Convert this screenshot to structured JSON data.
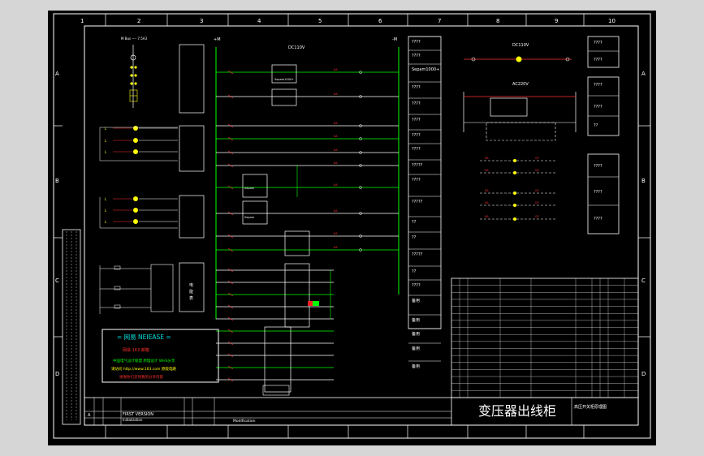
{
  "grid": {
    "columns": [
      "1",
      "2",
      "3",
      "4",
      "5",
      "6",
      "7",
      "8",
      "9",
      "10"
    ],
    "rows": [
      "A",
      "B",
      "C",
      "D"
    ]
  },
  "title_block": {
    "title": "变压器出线柜",
    "subtitle": "高压开关柜原理图",
    "revision_col": "A",
    "version_label": "FIRST VERSION",
    "version_sub": "Initialization",
    "modification": "Modification"
  },
  "dc_bus": {
    "left": "+M",
    "right": "-M",
    "label": "DC110V"
  },
  "ac_bus": {
    "label": "AC220V"
  },
  "dc_panel": {
    "label": "DC110V"
  },
  "relay_label": "Sepam1000+",
  "relay_label_short": "Sepam",
  "watermark": {
    "title": "= 网易 NEIEASE =",
    "lines": [
      "网易 163 邮箱",
      "中国电气设计联盟 原理设计 WHS分享",
      "请访问 http://www.163.com 原版电路",
      "谢谢你们支持我的分享内容"
    ]
  },
  "right_column_labels": [
    "????",
    "????",
    "Sepam1000+",
    "????",
    "????",
    "????",
    "????",
    "????",
    "?????",
    "????",
    "?????",
    "??",
    "??",
    "?????",
    "??",
    "????",
    "备用",
    "备用",
    "备用",
    "备用",
    "备用"
  ],
  "right_panel_labels": [
    "????",
    "????",
    "????",
    "????",
    "??",
    "????",
    "????",
    "????",
    "????"
  ],
  "bom_table": {
    "rows": 17
  },
  "colors": {
    "background": "#000000",
    "frame": "#ffffff",
    "wire": "#00ff00",
    "component": "#ff3030",
    "text": "#ffff00"
  }
}
